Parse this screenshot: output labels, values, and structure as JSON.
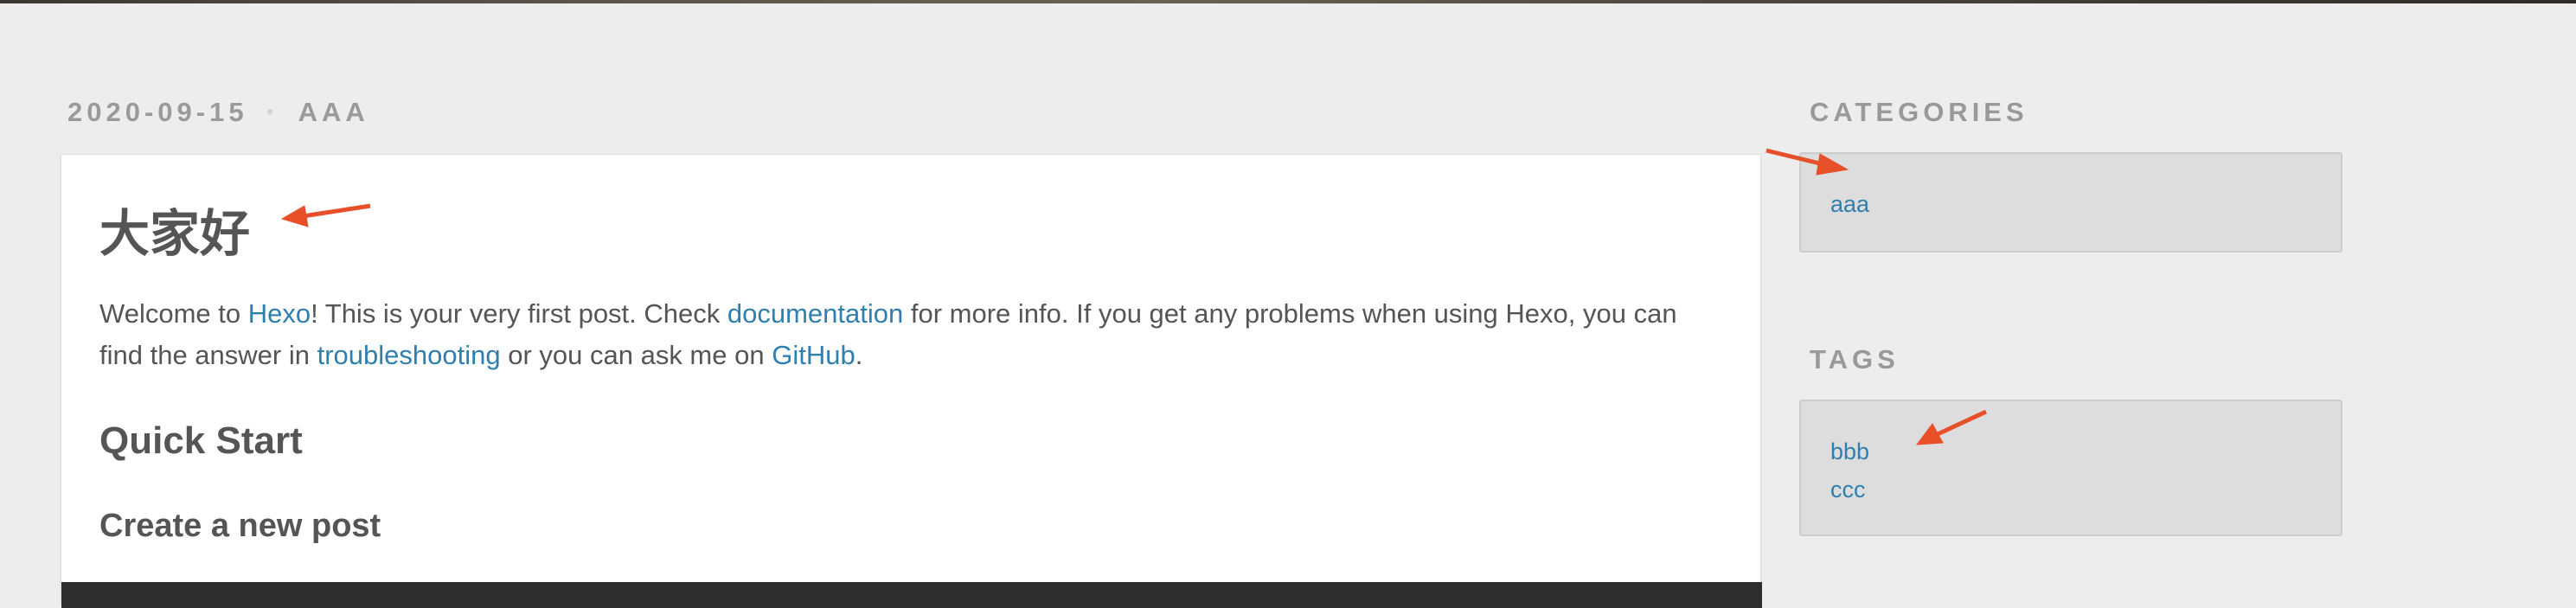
{
  "post": {
    "date": "2020-09-15",
    "separator": "•",
    "category": "AAA",
    "title": "大家好",
    "intro": {
      "t1": "Welcome to ",
      "link_hexo": "Hexo",
      "t2": "! This is your very first post. Check ",
      "link_docs": "documentation",
      "t3": " for more info. If you get any problems when using Hexo, you can find the answer in ",
      "link_troubleshooting": "troubleshooting",
      "t4": " or you can ask me on ",
      "link_github": "GitHub",
      "t5": "."
    },
    "heading_quick_start": "Quick Start",
    "heading_create_post": "Create a new post"
  },
  "sidebar": {
    "categories_title": "CATEGORIES",
    "categories": [
      "aaa"
    ],
    "tags_title": "TAGS",
    "tags": [
      "bbb",
      "ccc"
    ]
  },
  "colors": {
    "link": "#2f7fb0",
    "annotation_arrow": "#e8502a",
    "code_block": "#2d2d2d"
  }
}
